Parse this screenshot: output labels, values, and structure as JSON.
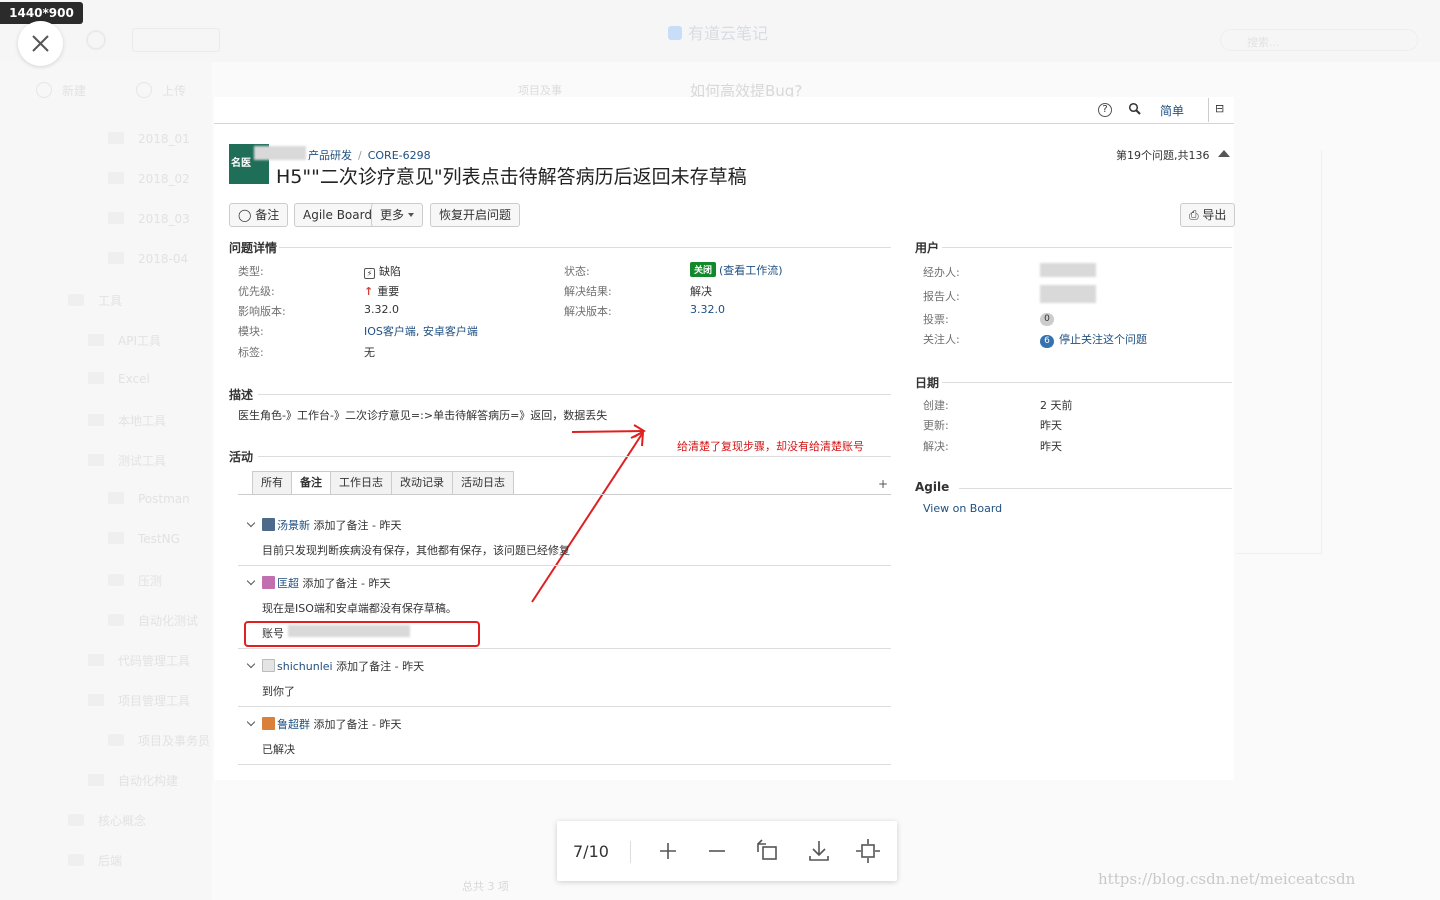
{
  "size_badge": "1440*900",
  "background": {
    "app_title": "有道云笔记",
    "search_placeholder": "搜索...",
    "new_label": "新建",
    "upload_label": "上传",
    "sidebar": [
      "2018_01",
      "2018_02",
      "2018_03",
      "2018-04",
      "工具",
      "API工具",
      "Excel",
      "本地工具",
      "测试工具",
      "Postman",
      "TestNG",
      "压测",
      "自动化测试",
      "代码管理工具",
      "项目管理工具",
      "项目及事务员",
      "自动化构建",
      "核心概念",
      "后端"
    ],
    "doc_breadcrumb": "项目及事",
    "doc_title": "如何高效提Bug?",
    "count": "总共 3 项"
  },
  "jira": {
    "simple_label": "简单",
    "breadcrumb_project": "产品研发",
    "breadcrumb_issue": "CORE-6298",
    "title": "H5\"\"二次诊疗意见\"列表点击待解答病历后返回未存草稿",
    "pager": "第19个问题,共136",
    "buttons": {
      "comment": "备注",
      "agile": "Agile Board",
      "more": "更多",
      "reopen": "恢复开启问题",
      "export": "导出"
    },
    "details": {
      "heading": "问题详情",
      "type_label": "类型:",
      "type_value": "缺陷",
      "priority_label": "优先级:",
      "priority_value": "重要",
      "affects_label": "影响版本:",
      "affects_value": "3.32.0",
      "component_label": "模块:",
      "component_value": "IOS客户端, 安卓客户端",
      "labels_label": "标签:",
      "labels_value": "无",
      "status_label": "状态:",
      "status_lozenge": "关闭",
      "status_workflow": "(查看工作流)",
      "resolution_label": "解决结果:",
      "resolution_value": "解决",
      "fixversion_label": "解决版本:",
      "fixversion_value": "3.32.0"
    },
    "people": {
      "heading": "用户",
      "assignee_label": "经办人:",
      "reporter_label": "报告人:",
      "votes_label": "投票:",
      "votes_value": "0",
      "watchers_label": "关注人:",
      "watchers_count": "6",
      "watch_link": "停止关注这个问题"
    },
    "dates": {
      "heading": "日期",
      "created_label": "创建:",
      "created_value": "2 天前",
      "updated_label": "更新:",
      "updated_value": "昨天",
      "resolved_label": "解决:",
      "resolved_value": "昨天"
    },
    "agile": {
      "heading": "Agile",
      "link": "View on Board"
    },
    "description": {
      "heading": "描述",
      "text": "医生角色-》工作台-》二次诊疗意见=:>单击待解答病历=》返回，数据丢失"
    },
    "annotation": "给清楚了复现步骤，却没有给清楚账号",
    "activity": {
      "heading": "活动",
      "tabs": [
        "所有",
        "备注",
        "工作日志",
        "改动记录",
        "活动日志"
      ],
      "comments": [
        {
          "author": "汤景新",
          "action": "添加了备注 - 昨天",
          "body": "目前只发现判断疾病没有保存，其他都有保存，该问题已经修复"
        },
        {
          "author": "匡超",
          "action": "添加了备注 - 昨天",
          "body": "现在是ISO端和安卓端都没有保存草稿。",
          "body2": "账号"
        },
        {
          "author": "shichunlei",
          "action": "添加了备注 - 昨天",
          "body": "到你了"
        },
        {
          "author": "鲁超群",
          "action": "添加了备注 - 昨天",
          "body": "已解决"
        }
      ]
    }
  },
  "viewer": {
    "page_indicator": "7/10"
  },
  "watermark": "https://blog.csdn.net/meiceatcsdn",
  "colors": {
    "link": "#205081",
    "status_closed": "#14892c",
    "annotation_red": "#e02020"
  },
  "icons": [
    "close-icon",
    "help-icon",
    "search-icon",
    "bug-icon",
    "priority-arrow-icon",
    "zoom-in-icon",
    "zoom-out-icon",
    "rotate-icon",
    "download-icon",
    "fit-screen-icon"
  ]
}
